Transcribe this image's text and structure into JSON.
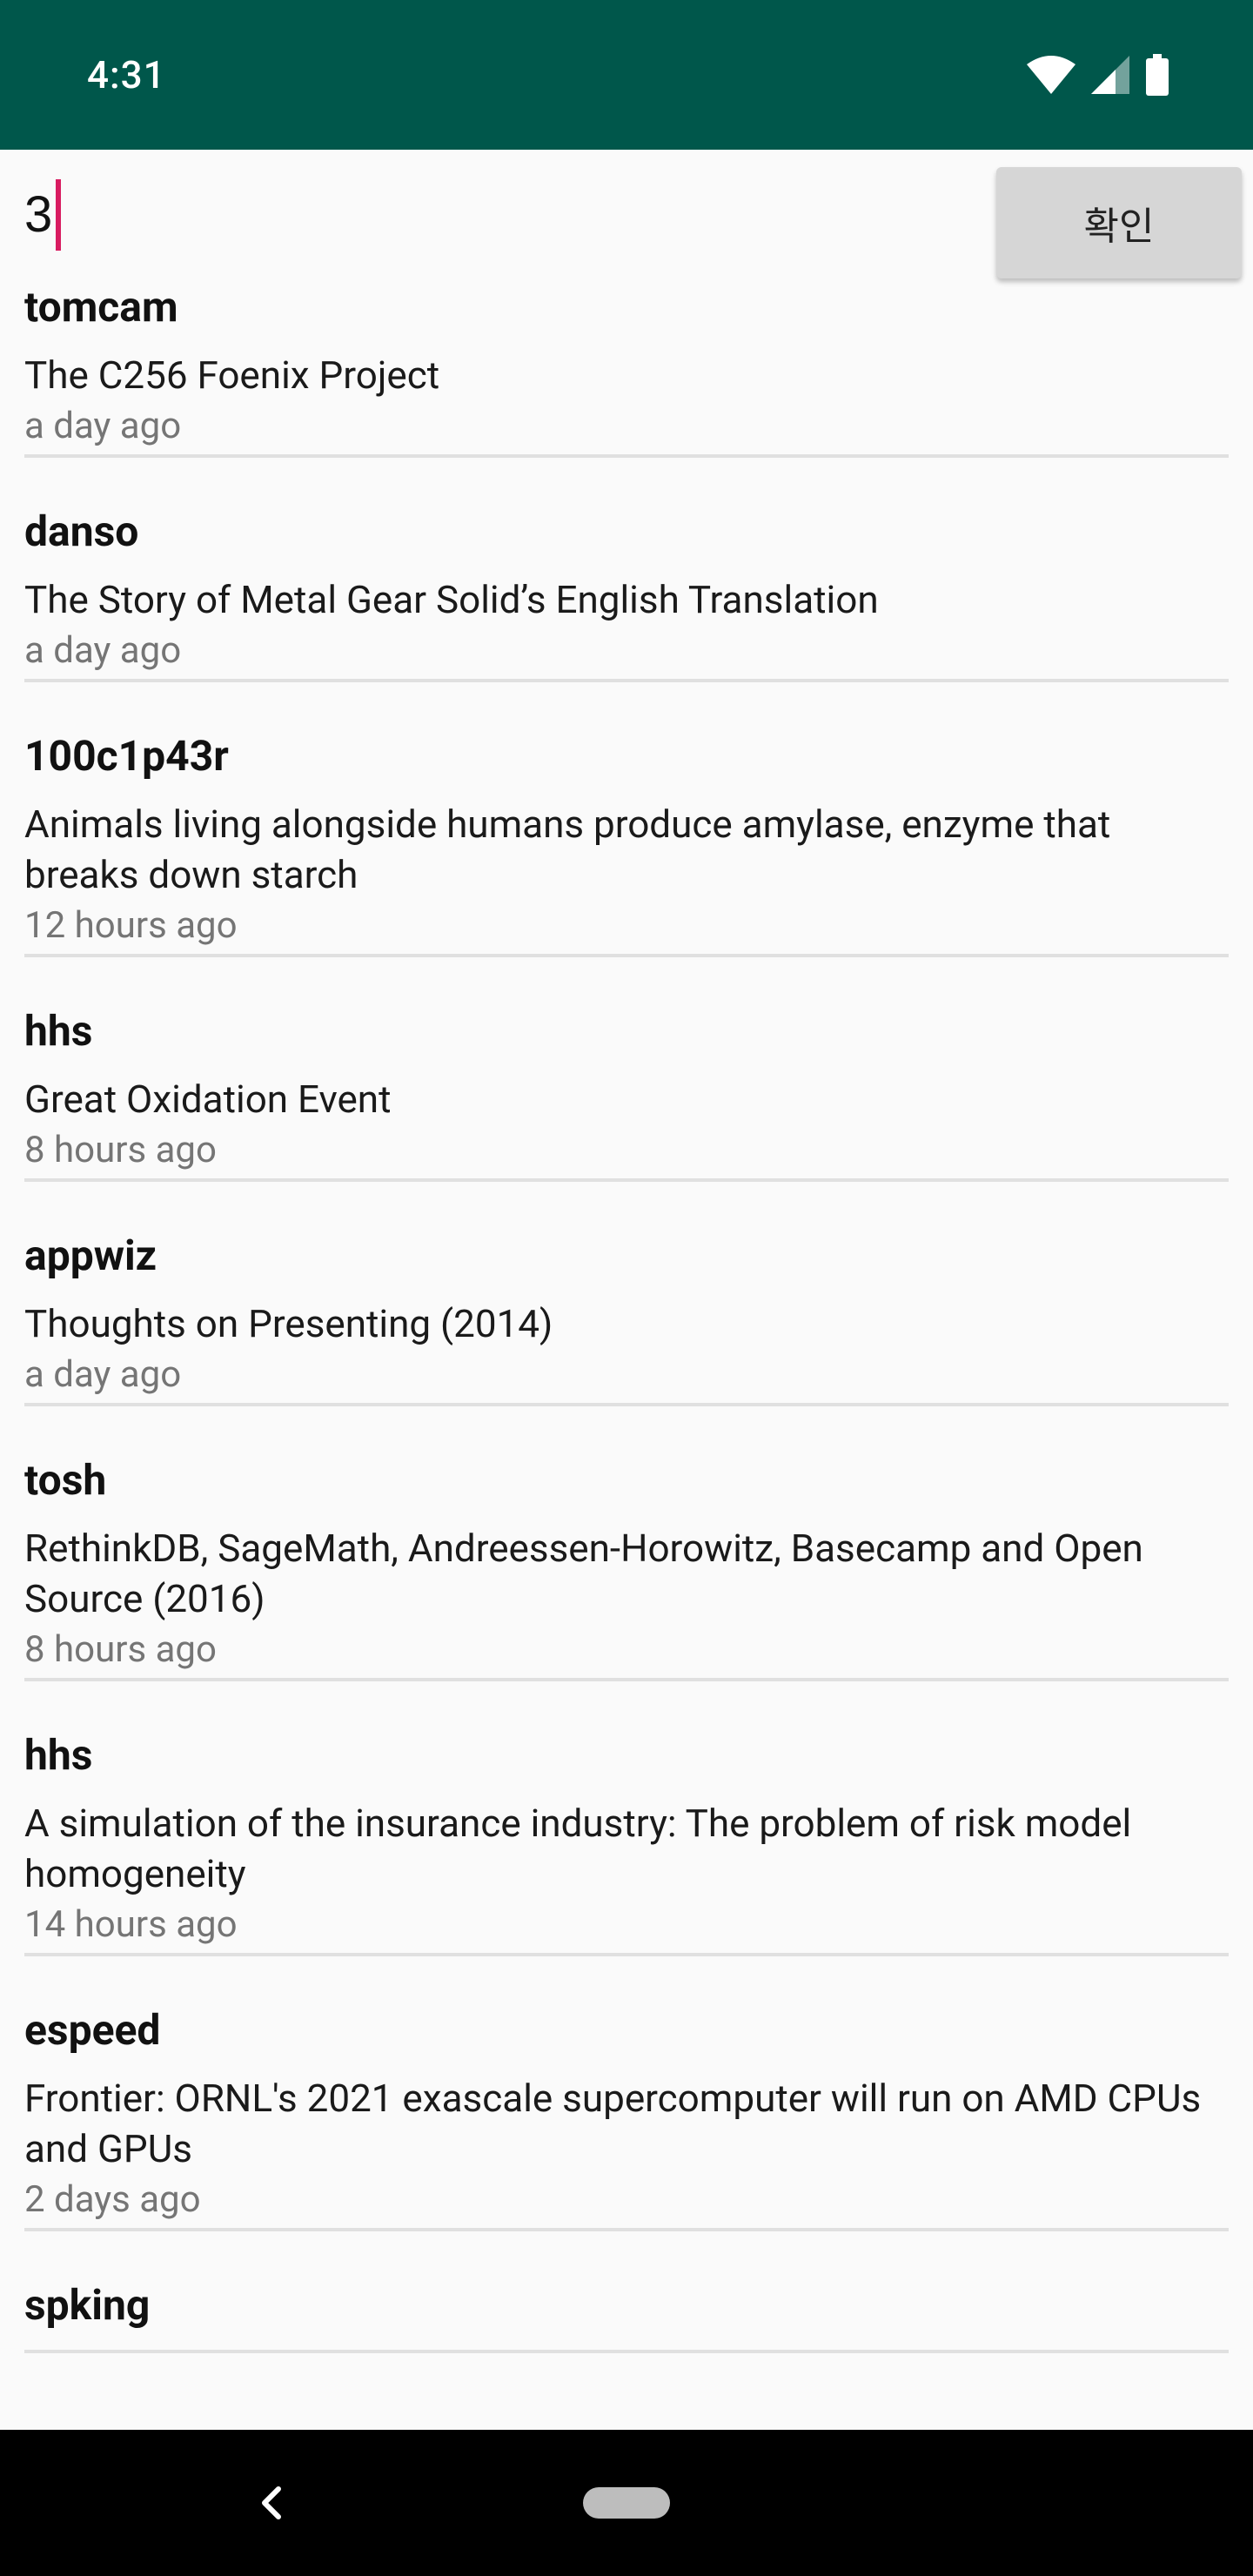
{
  "status_bar": {
    "time": "4:31",
    "icons": [
      "wifi-icon",
      "cell-signal-icon",
      "battery-icon"
    ],
    "background": "#00574b"
  },
  "search": {
    "value": "3",
    "caret_color": "#d81b60",
    "confirm_label": "확인"
  },
  "items": [
    {
      "author": "tomcam",
      "title": "The C256 Foenix Project",
      "time": "a day ago"
    },
    {
      "author": "danso",
      "title": "The Story of Metal Gear Solid’s English Translation",
      "time": "a day ago"
    },
    {
      "author": "100c1p43r",
      "title": "Animals living alongside humans produce amylase, enzyme that breaks down starch",
      "time": "12 hours ago"
    },
    {
      "author": "hhs",
      "title": "Great Oxidation Event",
      "time": "8 hours ago"
    },
    {
      "author": "appwiz",
      "title": "Thoughts on Presenting (2014)",
      "time": "a day ago"
    },
    {
      "author": "tosh",
      "title": "RethinkDB, SageMath, Andreessen-Horowitz, Basecamp and Open Source (2016)",
      "time": "8 hours ago"
    },
    {
      "author": "hhs",
      "title": "A simulation of the insurance industry: The problem of risk model homogeneity",
      "time": "14 hours ago"
    },
    {
      "author": "espeed",
      "title": "Frontier: ORNL's 2021 exascale supercomputer will run on AMD CPUs and GPUs",
      "time": "2 days ago"
    },
    {
      "author": "spking",
      "title": "",
      "time": ""
    }
  ],
  "nav_bar": {
    "icons": [
      "back-icon",
      "home-pill-icon"
    ]
  }
}
